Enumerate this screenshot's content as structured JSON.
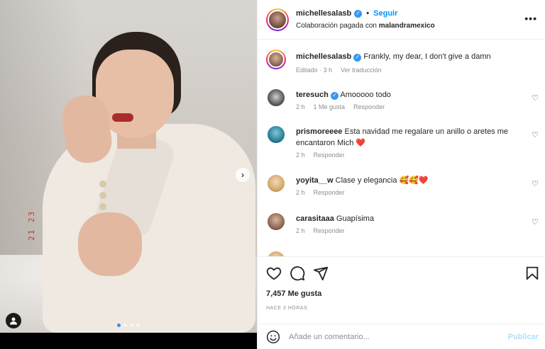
{
  "post": {
    "username": "michellesalasb",
    "follow_label": "Seguir",
    "separator": "•",
    "collab_prefix": "Colaboración pagada con",
    "collab_partner": "malandramexico",
    "more_label": "•••",
    "carousel_dots": 4,
    "carousel_active": 0,
    "photo_caption_handwriting": "21 23"
  },
  "caption": {
    "username": "michellesalasb",
    "text": "Frankly, my dear, I don't give a damn",
    "meta_edited": "Editado · 3 h",
    "meta_translate": "Ver traducción"
  },
  "comments": [
    {
      "username": "teresuch",
      "text": "Amooooo todo",
      "time": "2 h",
      "likes": "1 Me gusta",
      "reply": "Responder"
    },
    {
      "username": "prismoreeee",
      "text": "Esta navidad me regalare un anillo o aretes me encantaron Mich ❤️",
      "time": "2 h",
      "reply": "Responder"
    },
    {
      "username": "yoyita__w",
      "text": "Clase y elegancia 🥰🥰❤️",
      "time": "2 h",
      "reply": "Responder"
    },
    {
      "username": "carasitaaa",
      "text": "Guapísima",
      "time": "2 h",
      "reply": "Responder"
    },
    {
      "username": "",
      "text": "",
      "time": "",
      "reply": ""
    }
  ],
  "actions": {
    "likes": "7,457 Me gusta",
    "time_ago": "HACE 3 HORAS"
  },
  "composer": {
    "placeholder": "Añade un comentario...",
    "publish_label": "Publicar"
  },
  "colors": {
    "accent": "#0095f6",
    "verified": "#3897f0",
    "muted": "#8e8e8e",
    "publish_disabled": "#b2dffc"
  }
}
